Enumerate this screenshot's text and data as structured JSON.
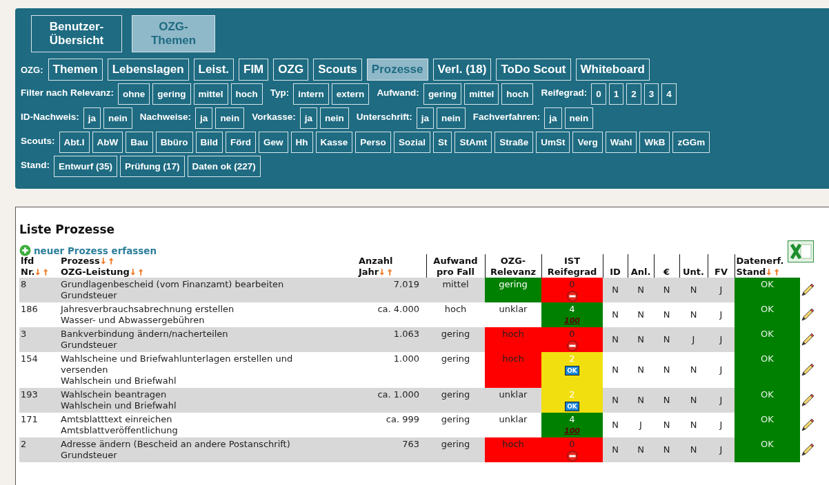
{
  "top_tabs": [
    {
      "label": "Benutzer-Übersicht",
      "selected": false
    },
    {
      "label": "OZG-Themen",
      "selected": true
    }
  ],
  "nav": {
    "label": "OZG:",
    "items": [
      {
        "label": "Themen",
        "selected": false
      },
      {
        "label": "Lebenslagen",
        "selected": false
      },
      {
        "label": "Leist.",
        "selected": false
      },
      {
        "label": "FIM",
        "selected": false
      },
      {
        "label": "OZG",
        "selected": false
      },
      {
        "label": "Scouts",
        "selected": false
      },
      {
        "label": "Prozesse",
        "selected": true
      },
      {
        "label": "Verl. (18)",
        "selected": false
      },
      {
        "label": "ToDo Scout",
        "selected": false
      },
      {
        "label": "Whiteboard",
        "selected": false
      }
    ]
  },
  "filter_rows": [
    [
      {
        "label": "Filter nach Relevanz:",
        "buttons": [
          "ohne",
          "gering",
          "mittel",
          "hoch"
        ]
      },
      {
        "label": "Typ:",
        "buttons": [
          "intern",
          "extern"
        ]
      },
      {
        "label": "Aufwand:",
        "buttons": [
          "gering",
          "mittel",
          "hoch"
        ]
      },
      {
        "label": "Reifegrad:",
        "buttons": [
          "0",
          "1",
          "2",
          "3",
          "4"
        ]
      }
    ],
    [
      {
        "label": "ID-Nachweis:",
        "buttons": [
          "ja",
          "nein"
        ]
      },
      {
        "label": "Nachweise:",
        "buttons": [
          "ja",
          "nein"
        ]
      },
      {
        "label": "Vorkasse:",
        "buttons": [
          "ja",
          "nein"
        ]
      },
      {
        "label": "Unterschrift:",
        "buttons": [
          "ja",
          "nein"
        ]
      },
      {
        "label": "Fachverfahren:",
        "buttons": [
          "ja",
          "nein"
        ]
      }
    ],
    [
      {
        "label": "Scouts:",
        "buttons": [
          "Abt.I",
          "AbW",
          "Bau",
          "Bbüro",
          "Bild",
          "Förd",
          "Gew",
          "Hh",
          "Kasse",
          "Perso",
          "Sozial",
          "St",
          "StAmt",
          "Straße",
          "UmSt",
          "Verg",
          "Wahl",
          "WkB",
          "zGGm"
        ]
      }
    ],
    [
      {
        "label": "Stand:",
        "buttons": [
          "Entwurf (35)",
          "Prüfung (17)",
          "Daten ok (227)"
        ]
      }
    ]
  ],
  "list": {
    "title": "Liste Prozesse",
    "new_link": "neuer Prozess erfassen",
    "columns": [
      {
        "kind": "left",
        "lines": [
          {
            "text": "lfd",
            "sortable": false
          },
          {
            "text": "Nr.",
            "sortable": true
          }
        ]
      },
      {
        "kind": "left",
        "lines": [
          {
            "text": "Prozess",
            "sortable": true
          },
          {
            "text": "OZG-Leistung",
            "sortable": true
          }
        ]
      },
      {
        "kind": "left",
        "lines": [
          {
            "text": "Anzahl",
            "sortable": false
          },
          {
            "text": "Jahr",
            "sortable": true
          }
        ]
      },
      {
        "kind": "center",
        "lines": [
          {
            "text": "Aufwand",
            "sortable": false
          },
          {
            "text": "pro Fall",
            "sortable": false
          }
        ]
      },
      {
        "kind": "center",
        "lines": [
          {
            "text": "OZG-",
            "sortable": false
          },
          {
            "text": "Relevanz",
            "sortable": false
          }
        ]
      },
      {
        "kind": "center",
        "lines": [
          {
            "text": "IST",
            "sortable": false
          },
          {
            "text": "Reifegrad",
            "sortable": false
          }
        ]
      },
      {
        "kind": "center",
        "lines": [
          {
            "text": "ID",
            "sortable": false
          }
        ]
      },
      {
        "kind": "center",
        "lines": [
          {
            "text": "Anl.",
            "sortable": false
          }
        ]
      },
      {
        "kind": "center",
        "lines": [
          {
            "text": "€",
            "sortable": false
          }
        ]
      },
      {
        "kind": "center",
        "lines": [
          {
            "text": "Unt.",
            "sortable": false
          }
        ]
      },
      {
        "kind": "center",
        "lines": [
          {
            "text": "FV",
            "sortable": false
          }
        ]
      },
      {
        "kind": "left",
        "lines": [
          {
            "text": "Datenerf.",
            "sortable": false
          },
          {
            "text": "Stand",
            "sortable": true
          }
        ]
      }
    ],
    "rows": [
      {
        "nr": "8",
        "prozess": "Grundlagenbescheid (vom Finanzamt) bearbeiten",
        "leistung": "Grundsteuer",
        "anzahl": "7.019",
        "aufwand": "mittel",
        "relevanz": {
          "text": "gering",
          "color": "#008000"
        },
        "reife": {
          "value": "0",
          "color": "#ff0000",
          "badge": {
            "kind": "stop"
          }
        },
        "flags": [
          "N",
          "N",
          "N",
          "N",
          "J"
        ],
        "stand": {
          "text": "OK",
          "color": "#008000"
        }
      },
      {
        "nr": "186",
        "prozess": "Jahresverbrauchsabrechnung erstellen",
        "leistung": "Wasser- und Abwassergebühren",
        "anzahl": "ca. 4.000",
        "aufwand": "hoch",
        "relevanz": {
          "text": "unklar"
        },
        "reife": {
          "value": "4",
          "color": "#008000",
          "badge": {
            "kind": "hundred",
            "text": "100"
          }
        },
        "flags": [
          "N",
          "N",
          "N",
          "N",
          "J"
        ],
        "stand": {
          "text": "OK",
          "color": "#008000"
        }
      },
      {
        "nr": "3",
        "prozess": "Bankverbindung ändern/nacherteilen",
        "leistung": "Grundsteuer",
        "anzahl": "1.063",
        "aufwand": "gering",
        "relevanz": {
          "text": "hoch",
          "color": "#ff0000"
        },
        "reife": {
          "value": "0",
          "color": "#ff0000",
          "badge": {
            "kind": "stop"
          }
        },
        "flags": [
          "N",
          "N",
          "N",
          "J",
          "J"
        ],
        "stand": {
          "text": "OK",
          "color": "#008000"
        }
      },
      {
        "nr": "154",
        "prozess": "Wahlscheine und Briefwahlunterlagen erstellen und versenden",
        "leistung": "Wahlschein und Briefwahl",
        "anzahl": "1.000",
        "aufwand": "gering",
        "relevanz": {
          "text": "hoch",
          "color": "#ff0000"
        },
        "reife": {
          "value": "2",
          "color": "#f2df10",
          "badge": {
            "kind": "ok",
            "text": "OK"
          }
        },
        "flags": [
          "N",
          "N",
          "N",
          "N",
          "J"
        ],
        "stand": {
          "text": "OK",
          "color": "#008000"
        }
      },
      {
        "nr": "193",
        "prozess": "Wahlschein beantragen",
        "leistung": "Wahlschein und Briefwahl",
        "anzahl": "ca. 1.000",
        "aufwand": "gering",
        "relevanz": {
          "text": "unklar"
        },
        "reife": {
          "value": "2",
          "color": "#f2df10",
          "badge": {
            "kind": "ok",
            "text": "OK"
          }
        },
        "flags": [
          "N",
          "N",
          "N",
          "N",
          "J"
        ],
        "stand": {
          "text": "OK",
          "color": "#008000"
        }
      },
      {
        "nr": "171",
        "prozess": "Amtsblatttext einreichen",
        "leistung": "Amtsblattveröffentlichung",
        "anzahl": "ca. 999",
        "aufwand": "gering",
        "relevanz": {
          "text": "unklar"
        },
        "reife": {
          "value": "4",
          "color": "#008000",
          "badge": {
            "kind": "hundred",
            "text": "100"
          }
        },
        "flags": [
          "N",
          "J",
          "N",
          "N",
          "J"
        ],
        "stand": {
          "text": "OK",
          "color": "#008000"
        }
      },
      {
        "nr": "2",
        "prozess": "Adresse ändern (Bescheid an andere Postanschrift)",
        "leistung": "Grundsteuer",
        "anzahl": "763",
        "aufwand": "gering",
        "relevanz": {
          "text": "hoch",
          "color": "#ff0000"
        },
        "reife": {
          "value": "0",
          "color": "#ff0000",
          "badge": {
            "kind": "stop"
          }
        },
        "flags": [
          "N",
          "N",
          "N",
          "N",
          "J"
        ],
        "stand": {
          "text": "OK",
          "color": "#008000"
        }
      }
    ]
  }
}
